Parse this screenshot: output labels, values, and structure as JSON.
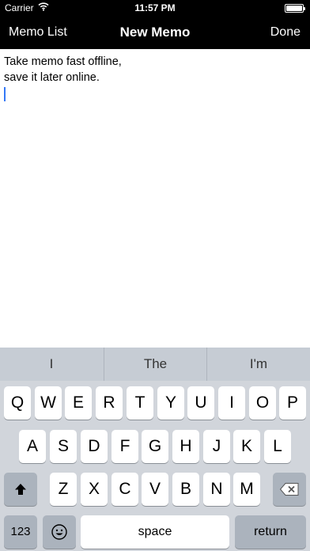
{
  "status_bar": {
    "carrier": "Carrier",
    "time": "11:57 PM"
  },
  "nav_bar": {
    "left_label": "Memo List",
    "title": "New Memo",
    "right_label": "Done"
  },
  "memo": {
    "lines": [
      "Take memo fast offline,",
      "save it later online."
    ]
  },
  "keyboard": {
    "suggestions": [
      "I",
      "The",
      "I'm"
    ],
    "row1": [
      "Q",
      "W",
      "E",
      "R",
      "T",
      "Y",
      "U",
      "I",
      "O",
      "P"
    ],
    "row2": [
      "A",
      "S",
      "D",
      "F",
      "G",
      "H",
      "J",
      "K",
      "L"
    ],
    "row3": [
      "Z",
      "X",
      "C",
      "V",
      "B",
      "N",
      "M"
    ],
    "numbers_label": "123",
    "space_label": "space",
    "return_label": "return",
    "icons": {
      "shift": "shift-arrow-icon",
      "delete": "backspace-icon",
      "emoji": "emoji-smiley-icon",
      "wifi": "wifi-icon",
      "battery": "battery-icon"
    }
  }
}
